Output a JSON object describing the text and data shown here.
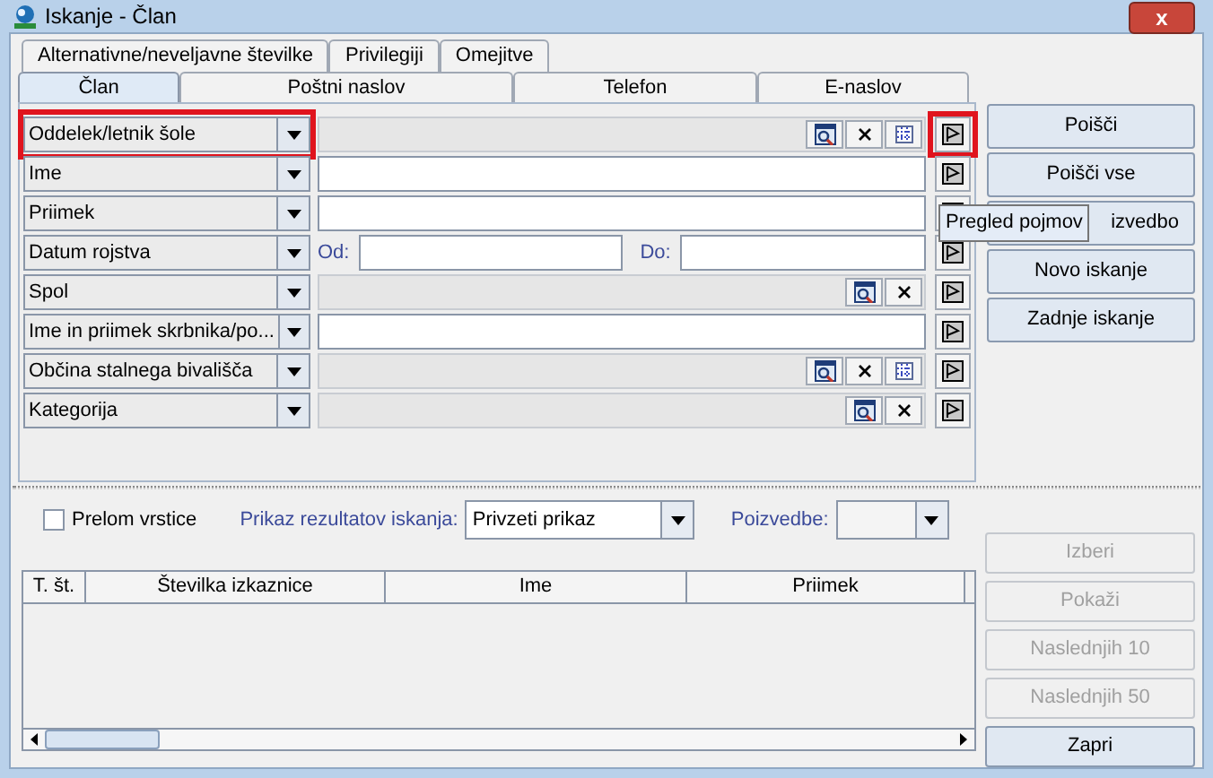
{
  "window": {
    "title": "Iskanje - Član",
    "close": "x"
  },
  "tabs_back": [
    {
      "label": "Alternativne/neveljavne številke",
      "selected": false
    },
    {
      "label": "Privilegiji",
      "selected": false
    },
    {
      "label": "Omejitve",
      "selected": false
    }
  ],
  "tabs_front": [
    {
      "label": "Član",
      "selected": true
    },
    {
      "label": "Poštni naslov",
      "selected": false
    },
    {
      "label": "Telefon",
      "selected": false
    },
    {
      "label": "E-naslov",
      "selected": false
    }
  ],
  "criteria": [
    {
      "field": "Oddelek/letnik šole",
      "kind": "lookup",
      "tools": [
        {
          "kind": "search"
        },
        {
          "kind": "clear"
        },
        {
          "kind": "grid"
        }
      ],
      "highlight_field": true,
      "highlight_flag": true
    },
    {
      "field": "Ime",
      "kind": "text",
      "highlight_field": false,
      "highlight_flag": false
    },
    {
      "field": "Priimek",
      "kind": "text",
      "highlight_field": false,
      "highlight_flag": false
    },
    {
      "field": "Datum rojstva",
      "kind": "range",
      "from_label": "Od:",
      "to_label": "Do:",
      "highlight_field": false,
      "highlight_flag": false
    },
    {
      "field": "Spol",
      "kind": "lookup",
      "tools": [
        {
          "kind": "search"
        },
        {
          "kind": "clear"
        }
      ],
      "highlight_field": false,
      "highlight_flag": false
    },
    {
      "field": "Ime in priimek skrbnika/po...",
      "kind": "text",
      "highlight_field": false,
      "highlight_flag": false
    },
    {
      "field": "Občina stalnega bivališča",
      "kind": "lookup",
      "tools": [
        {
          "kind": "search"
        },
        {
          "kind": "clear"
        },
        {
          "kind": "grid"
        }
      ],
      "highlight_field": false,
      "highlight_flag": false
    },
    {
      "field": "Kategorija",
      "kind": "lookup",
      "tools": [
        {
          "kind": "search"
        },
        {
          "kind": "clear"
        }
      ],
      "highlight_field": false,
      "highlight_flag": false
    }
  ],
  "side_buttons": [
    {
      "label": "Poišči",
      "disabled": false
    },
    {
      "label": "Poišči vse",
      "disabled": false
    },
    {
      "label": "izvedbo",
      "disabled": false
    },
    {
      "label": "Novo iskanje",
      "disabled": false
    },
    {
      "label": "Zadnje iskanje",
      "disabled": false
    }
  ],
  "tooltip": "Pregled pojmov",
  "options": {
    "line_break": {
      "label": "Prelom vrstice",
      "checked": false
    },
    "display_label": "Prikaz rezultatov iskanja:",
    "display_value": "Privzeti prikaz",
    "queries_label": "Poizvedbe:"
  },
  "table": {
    "columns": [
      "T. št.",
      "Številka izkaznice",
      "Ime",
      "Priimek"
    ]
  },
  "result_buttons": [
    {
      "label": "Izberi",
      "disabled": true
    },
    {
      "label": "Pokaži",
      "disabled": true
    },
    {
      "label": "Naslednjih 10",
      "disabled": true
    },
    {
      "label": "Naslednjih 50",
      "disabled": true
    },
    {
      "label": "Zapri",
      "disabled": false
    }
  ]
}
